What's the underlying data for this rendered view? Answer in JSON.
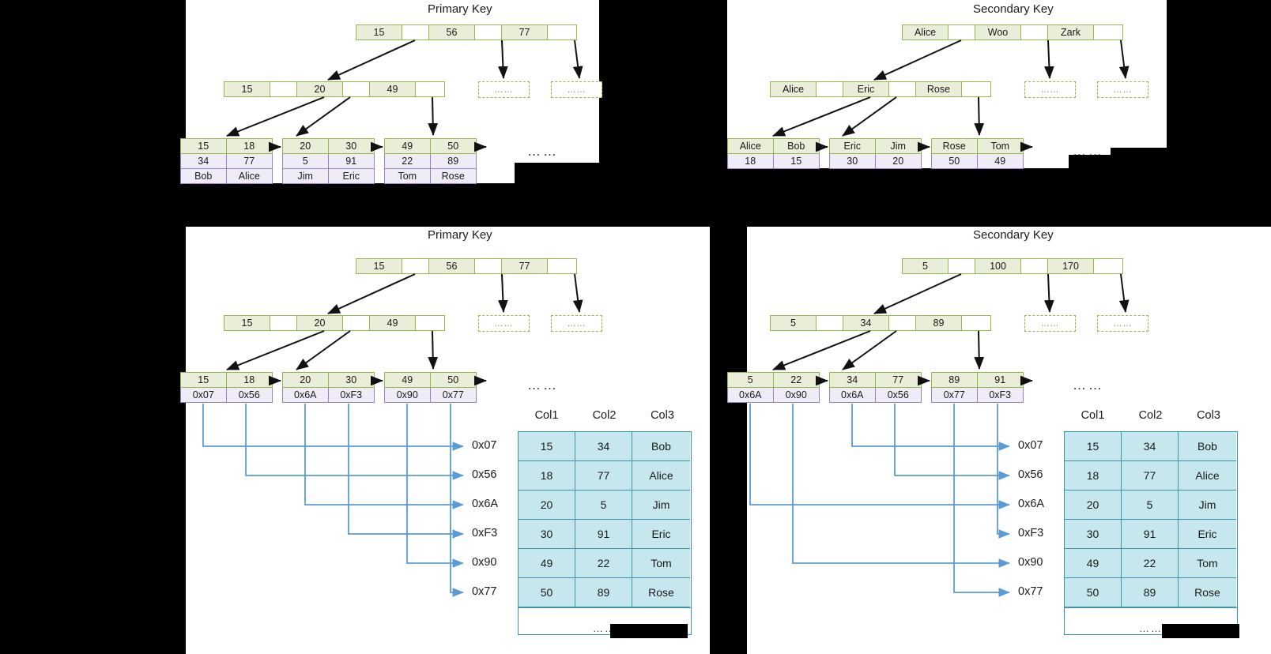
{
  "panels": {
    "tl": {
      "title": "Primary Key"
    },
    "tr": {
      "title": "Secondary Key"
    },
    "bl": {
      "title": "Primary Key"
    },
    "br": {
      "title": "Secondary Key"
    }
  },
  "colors": {
    "node_border": "#94b84a",
    "node_key_fill": "#e8eed8",
    "value_border": "#9b80c0",
    "value_fill": "#f0ecf7",
    "table_border": "#3f93a8",
    "table_fill": "#c6e7ee",
    "connector": "#5b9bd5",
    "background": "#000000",
    "panel": "#ffffff"
  },
  "ellipsis": "……",
  "tl": {
    "root": [
      "15",
      "",
      "56",
      "",
      "77",
      ""
    ],
    "internal": [
      "15",
      "",
      "20",
      "",
      "49",
      ""
    ],
    "stub1": "……",
    "stub2": "……",
    "leaves": [
      {
        "keys": [
          "15",
          "18"
        ],
        "r2": [
          "34",
          "77"
        ],
        "r3": [
          "Bob",
          "Alice"
        ]
      },
      {
        "keys": [
          "20",
          "30"
        ],
        "r2": [
          "5",
          "91"
        ],
        "r3": [
          "Jim",
          "Eric"
        ]
      },
      {
        "keys": [
          "49",
          "50"
        ],
        "r2": [
          "22",
          "89"
        ],
        "r3": [
          "Tom",
          "Rose"
        ]
      }
    ],
    "trailing_dots": "……"
  },
  "tr": {
    "root": [
      "Alice",
      "",
      "Woo",
      "",
      "Zark",
      ""
    ],
    "internal": [
      "Alice",
      "",
      "Eric",
      "",
      "Rose",
      ""
    ],
    "stub1": "……",
    "stub2": "……",
    "leaves": [
      {
        "keys": [
          "Alice",
          "Bob"
        ],
        "r2": [
          "18",
          "15"
        ]
      },
      {
        "keys": [
          "Eric",
          "Jim"
        ],
        "r2": [
          "30",
          "20"
        ]
      },
      {
        "keys": [
          "Rose",
          "Tom"
        ],
        "r2": [
          "50",
          "49"
        ]
      }
    ],
    "trailing_dots": "……"
  },
  "bl": {
    "root": [
      "15",
      "",
      "56",
      "",
      "77",
      ""
    ],
    "internal": [
      "15",
      "",
      "20",
      "",
      "49",
      ""
    ],
    "stub1": "……",
    "stub2": "……",
    "leaves": [
      {
        "keys": [
          "15",
          "18"
        ],
        "ptrs": [
          "0x07",
          "0x56"
        ]
      },
      {
        "keys": [
          "20",
          "30"
        ],
        "ptrs": [
          "0x6A",
          "0xF3"
        ]
      },
      {
        "keys": [
          "49",
          "50"
        ],
        "ptrs": [
          "0x90",
          "0x77"
        ]
      }
    ],
    "trailing_dots": "……",
    "addresses": [
      "0x07",
      "0x56",
      "0x6A",
      "0xF3",
      "0x90",
      "0x77"
    ],
    "table": {
      "columns": [
        "Col1",
        "Col2",
        "Col3"
      ],
      "rows": [
        [
          "15",
          "34",
          "Bob"
        ],
        [
          "18",
          "77",
          "Alice"
        ],
        [
          "20",
          "5",
          "Jim"
        ],
        [
          "30",
          "91",
          "Eric"
        ],
        [
          "49",
          "22",
          "Tom"
        ],
        [
          "50",
          "89",
          "Rose"
        ]
      ],
      "tail": "……"
    }
  },
  "br": {
    "root": [
      "5",
      "",
      "100",
      "",
      "170",
      ""
    ],
    "internal": [
      "5",
      "",
      "34",
      "",
      "89",
      ""
    ],
    "stub1": "……",
    "stub2": "……",
    "leaves": [
      {
        "keys": [
          "5",
          "22"
        ],
        "ptrs": [
          "0x6A",
          "0x90"
        ]
      },
      {
        "keys": [
          "34",
          "77"
        ],
        "ptrs": [
          "0x6A",
          "0x56"
        ]
      },
      {
        "keys": [
          "89",
          "91"
        ],
        "ptrs": [
          "0x77",
          "0xF3"
        ]
      }
    ],
    "trailing_dots": "……",
    "addresses": [
      "0x07",
      "0x56",
      "0x6A",
      "0xF3",
      "0x90",
      "0x77"
    ],
    "table": {
      "columns": [
        "Col1",
        "Col2",
        "Col3"
      ],
      "rows": [
        [
          "15",
          "34",
          "Bob"
        ],
        [
          "18",
          "77",
          "Alice"
        ],
        [
          "20",
          "5",
          "Jim"
        ],
        [
          "30",
          "91",
          "Eric"
        ],
        [
          "49",
          "22",
          "Tom"
        ],
        [
          "50",
          "89",
          "Rose"
        ]
      ],
      "tail": "……"
    }
  }
}
